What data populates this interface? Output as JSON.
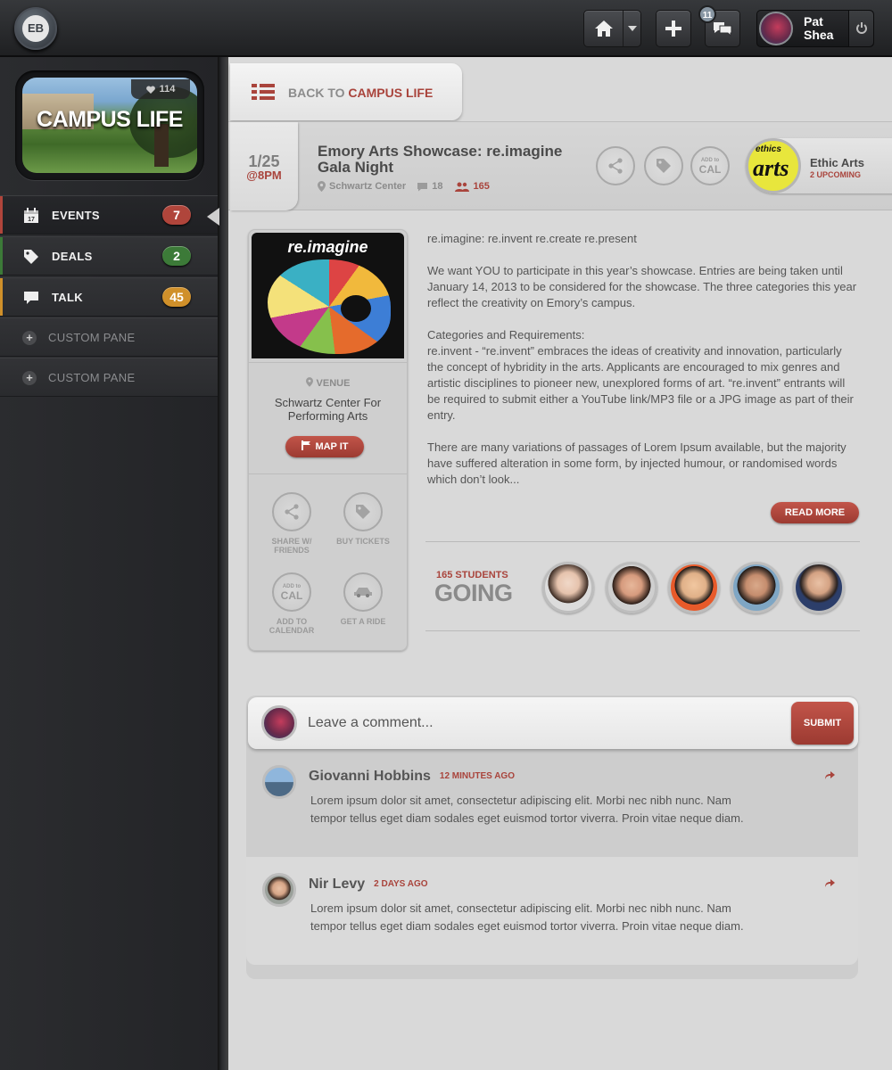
{
  "topbar": {
    "logo_text": "EB",
    "messages_count": "11",
    "user_name": "Pat Shea"
  },
  "sidebar": {
    "hero_title": "CAMPUS LIFE",
    "likes": "114",
    "items": [
      {
        "label": "EVENTS",
        "count": "7",
        "color": "#b0453b"
      },
      {
        "label": "DEALS",
        "count": "2",
        "color": "#3c7a38"
      },
      {
        "label": "TALK",
        "count": "45",
        "color": "#d0902a"
      }
    ],
    "custom_panes": [
      "CUSTOM PANE",
      "CUSTOM PANE"
    ]
  },
  "back": {
    "prefix": "BACK TO",
    "target": "CAMPUS LIFE"
  },
  "event": {
    "date": "1/25",
    "time": "@8PM",
    "title": "Emory Arts Showcase: re.imagine Gala Night",
    "location": "Schwartz Center",
    "comments": "18",
    "attendees": "165",
    "add_cal_small": "ADD to",
    "add_cal_big": "CAL",
    "org_name": "Ethic Arts",
    "org_upcoming": "2 UPCOMING",
    "org_logo_text_top": "ethics",
    "org_logo_text_main": "arts"
  },
  "venue": {
    "poster_title": "re.imagine",
    "label": "VENUE",
    "name": "Schwartz Center For Performing Arts",
    "map_button": "MAP IT",
    "actions": [
      {
        "label": "SHARE W/ FRIENDS"
      },
      {
        "label": "BUY TICKETS"
      },
      {
        "label": "ADD TO CALENDAR"
      },
      {
        "label": "GET A RIDE"
      }
    ]
  },
  "description": {
    "p1": "re.imagine: re.invent re.create re.present",
    "p2": "We want YOU to participate in this year’s showcase. Entries are being taken until January 14, 2013 to be considered for the showcase. The three categories this year reflect the creativity on Emory’s campus.",
    "p3a": "Categories and Requirements:",
    "p3b": "re.invent - “re.invent” embraces the ideas of creativity and innovation, particularly the concept of hybridity in the arts. Applicants are encouraged to mix genres and artistic disciplines to pioneer new, unexplored forms of art. “re.invent” entrants will be required to submit either a YouTube link/MP3 file or a JPG image as part of their entry.",
    "p4": "There are many variations of passages of Lorem Ipsum available, but the majority have suffered alteration in some form, by injected humour, or randomised words which don’t look...",
    "read_more": "READ MORE"
  },
  "going": {
    "count_label": "165 STUDENTS",
    "word": "GOING"
  },
  "comments": {
    "placeholder": "Leave a comment...",
    "submit": "SUBMIT",
    "items": [
      {
        "name": "Giovanni Hobbins",
        "time": "12 MINUTES AGO",
        "text": "Lorem ipsum dolor sit amet, consectetur adipiscing elit. Morbi nec nibh nunc. Nam tempor tellus eget diam sodales eget euismod tortor viverra. Proin vitae neque diam."
      },
      {
        "name": "Nir Levy",
        "time": "2 DAYS AGO",
        "text": "Lorem ipsum dolor sit amet, consectetur adipiscing elit. Morbi nec nibh nunc. Nam tempor tellus eget diam sodales eget euismod tortor viverra. Proin vitae neque diam."
      }
    ]
  }
}
